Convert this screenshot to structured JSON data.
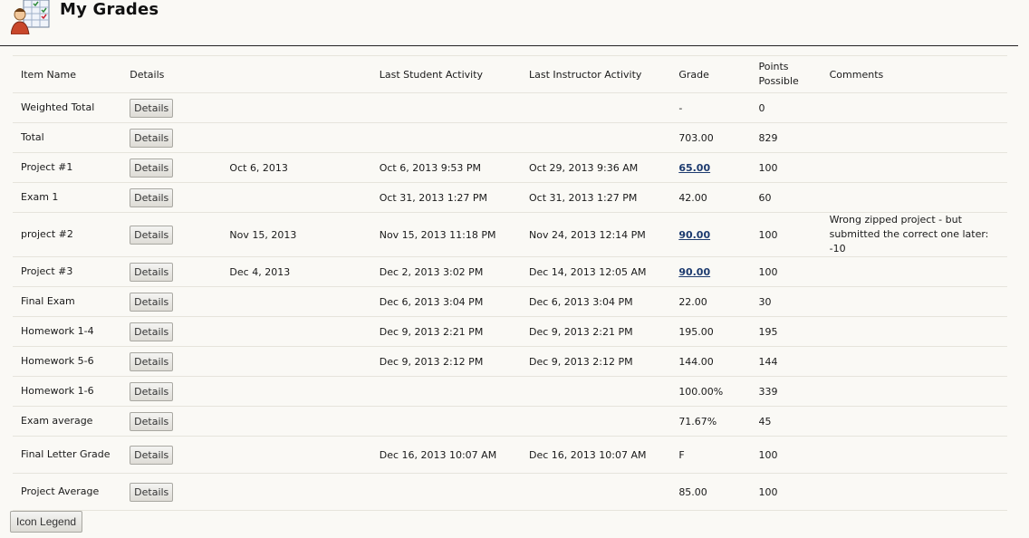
{
  "header": {
    "title": "My Grades",
    "icon": "grades-person-icon"
  },
  "columns": {
    "item_name": "Item Name",
    "details": "Details",
    "date": "",
    "last_student_activity": "Last Student Activity",
    "last_instructor_activity": "Last Instructor Activity",
    "grade": "Grade",
    "points_possible": "Points Possible",
    "comments": "Comments"
  },
  "details_label": "Details",
  "rows": [
    {
      "name": "Weighted Total",
      "date": "",
      "student": "",
      "instructor": "",
      "grade": "-",
      "grade_link": false,
      "points": "0",
      "comment": ""
    },
    {
      "name": "Total",
      "date": "",
      "student": "",
      "instructor": "",
      "grade": "703.00",
      "grade_link": false,
      "points": "829",
      "comment": ""
    },
    {
      "name": "Project #1",
      "date": "Oct 6, 2013",
      "student": "Oct 6, 2013 9:53 PM",
      "instructor": "Oct 29, 2013 9:36 AM",
      "grade": "65.00",
      "grade_link": true,
      "points": "100",
      "comment": ""
    },
    {
      "name": "Exam 1",
      "date": "",
      "student": "Oct 31, 2013 1:27 PM",
      "instructor": "Oct 31, 2013 1:27 PM",
      "grade": "42.00",
      "grade_link": false,
      "points": "60",
      "comment": ""
    },
    {
      "name": "project #2",
      "date": "Nov 15, 2013",
      "student": "Nov 15, 2013 11:18 PM",
      "instructor": "Nov 24, 2013 12:14 PM",
      "grade": "90.00",
      "grade_link": true,
      "points": "100",
      "comment": "Wrong zipped project - but submitted the correct one later: -10"
    },
    {
      "name": "Project #3",
      "date": "Dec 4, 2013",
      "student": "Dec 2, 2013 3:02 PM",
      "instructor": "Dec 14, 2013 12:05 AM",
      "grade": "90.00",
      "grade_link": true,
      "points": "100",
      "comment": ""
    },
    {
      "name": "Final Exam",
      "date": "",
      "student": "Dec 6, 2013 3:04 PM",
      "instructor": "Dec 6, 2013 3:04 PM",
      "grade": "22.00",
      "grade_link": false,
      "points": "30",
      "comment": ""
    },
    {
      "name": "Homework 1-4",
      "date": "",
      "student": "Dec 9, 2013 2:21 PM",
      "instructor": "Dec 9, 2013 2:21 PM",
      "grade": "195.00",
      "grade_link": false,
      "points": "195",
      "comment": ""
    },
    {
      "name": "Homework 5-6",
      "date": "",
      "student": "Dec 9, 2013 2:12 PM",
      "instructor": "Dec 9, 2013 2:12 PM",
      "grade": "144.00",
      "grade_link": false,
      "points": "144",
      "comment": ""
    },
    {
      "name": "Homework 1-6",
      "date": "",
      "student": "",
      "instructor": "",
      "grade": "100.00%",
      "grade_link": false,
      "points": "339",
      "comment": ""
    },
    {
      "name": "Exam average",
      "date": "",
      "student": "",
      "instructor": "",
      "grade": "71.67%",
      "grade_link": false,
      "points": "45",
      "comment": ""
    },
    {
      "name": "Final Letter Grade",
      "date": "",
      "student": "Dec 16, 2013 10:07 AM",
      "instructor": "Dec 16, 2013 10:07 AM",
      "grade": "F",
      "grade_link": false,
      "points": "100",
      "comment": ""
    },
    {
      "name": "Project Average",
      "date": "",
      "student": "",
      "instructor": "",
      "grade": "85.00",
      "grade_link": false,
      "points": "100",
      "comment": ""
    }
  ],
  "footer": {
    "icon_legend_label": "Icon Legend"
  },
  "colors": {
    "background": "#faf9f5",
    "link": "#1d3b6f",
    "row_border": "#e6e4dc"
  }
}
